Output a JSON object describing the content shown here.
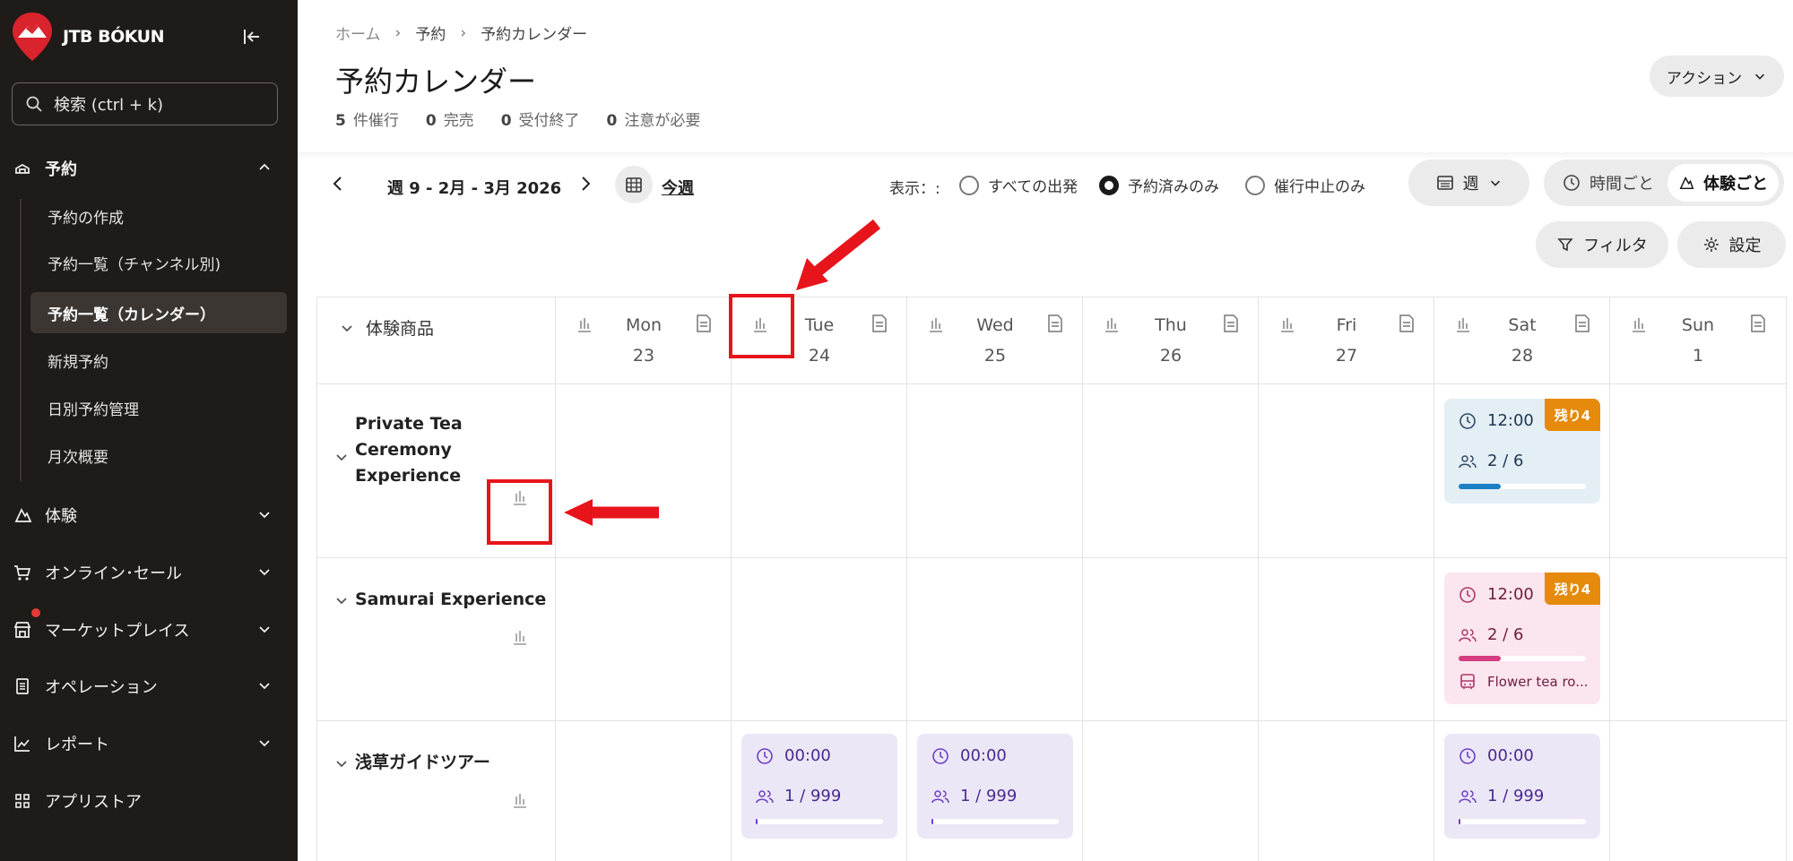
{
  "brand": {
    "name": "JTB BÓKUN",
    "logo_color": "#d9232d"
  },
  "search": {
    "placeholder": "検索 (ctrl + k)"
  },
  "nav": {
    "reservations": "予約",
    "sub_items": [
      "予約の作成",
      "予約一覧（チャンネル別)",
      "予約一覧（カレンダー）",
      "新規予約",
      "日別予約管理",
      "月次概要"
    ],
    "active_sub_index": 2,
    "sections": [
      "体験",
      "オンライン･セール",
      "マーケットプレイス",
      "オペレーション",
      "レポート",
      "アプリストア"
    ]
  },
  "breadcrumbs": [
    "ホーム",
    "予約",
    "予約カレンダー"
  ],
  "page_title": "予約カレンダー",
  "stats": [
    {
      "count": "5",
      "label": "件催行"
    },
    {
      "count": "0",
      "label": "完売"
    },
    {
      "count": "0",
      "label": "受付終了"
    },
    {
      "count": "0",
      "label": "注意が必要"
    }
  ],
  "action_button": "アクション",
  "toolbar": {
    "week_label": "週 9 - 2月 - 3月 2026",
    "this_week": "今週",
    "display_label": "表示：:",
    "radio_options": [
      "すべての出発",
      "予約済みのみ",
      "催行中止のみ"
    ],
    "radio_selected": 1,
    "view_select": "週",
    "segment": [
      "時間ごと",
      "体験ごと"
    ],
    "segment_selected": 1,
    "filter": "フィルタ",
    "settings": "設定"
  },
  "grid": {
    "corner_label": "体験商品",
    "days": [
      {
        "name": "Mon",
        "num": "23"
      },
      {
        "name": "Tue",
        "num": "24"
      },
      {
        "name": "Wed",
        "num": "25"
      },
      {
        "name": "Thu",
        "num": "26"
      },
      {
        "name": "Fri",
        "num": "27"
      },
      {
        "name": "Sat",
        "num": "28"
      },
      {
        "name": "Sun",
        "num": "1"
      }
    ],
    "rows": [
      {
        "name": "Private Tea Ceremony Experience"
      },
      {
        "name": "Samurai Experience"
      },
      {
        "name": "浅草ガイドツアー"
      }
    ]
  },
  "cards": {
    "tea_sat": {
      "time": "12:00",
      "pax": "2 / 6",
      "badge": "残り4",
      "fill": 0.33,
      "color": "#1b7fc4"
    },
    "samurai_sat": {
      "time": "12:00",
      "pax": "2 / 6",
      "badge": "残り4",
      "fill": 0.33,
      "color": "#d63c80",
      "resource": "Flower tea ro..."
    },
    "asakusa_tue": {
      "time": "00:00",
      "pax": "1 / 999",
      "fill": 0.01,
      "color": "#6d3fc6"
    },
    "asakusa_wed": {
      "time": "00:00",
      "pax": "1 / 999",
      "fill": 0.01,
      "color": "#6d3fc6"
    },
    "asakusa_sat": {
      "time": "00:00",
      "pax": "1 / 999",
      "fill": 0.01,
      "color": "#6d3fc6"
    }
  },
  "icons": {
    "badge_color": "#e58a0b",
    "annotation_color": "#e8141b"
  }
}
